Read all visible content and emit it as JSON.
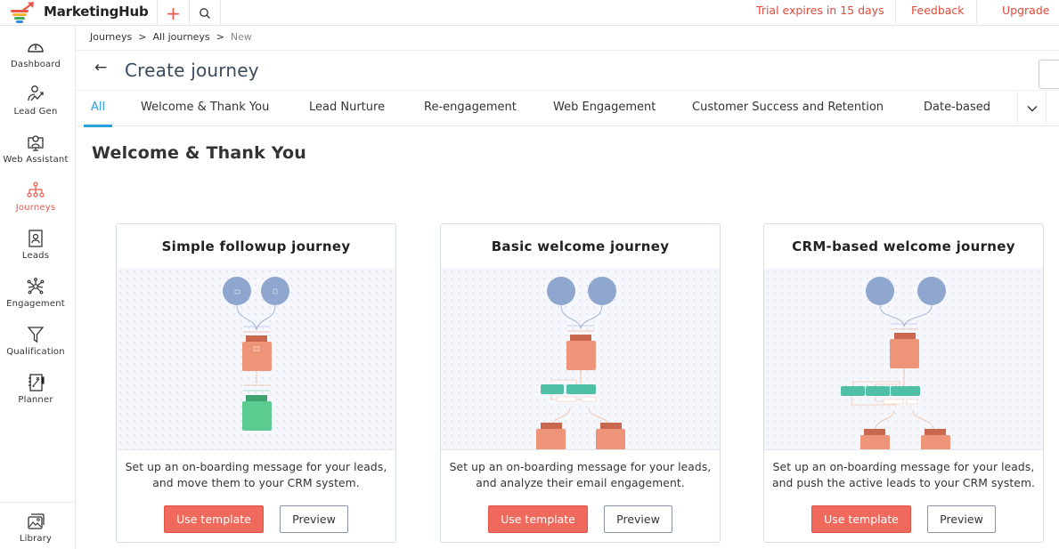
{
  "app": {
    "name": "MarketingHub"
  },
  "topbar": {
    "trial_text": "Trial expires in 15 days",
    "feedback_label": "Feedback",
    "upgrade_label": "Upgrade",
    "accent_color": "#e04b3c"
  },
  "sidebar": {
    "items": [
      {
        "label": "Dashboard",
        "icon": "gauge-icon"
      },
      {
        "label": "Lead Gen",
        "icon": "lead-gen-icon"
      },
      {
        "label": "Web Assistant",
        "icon": "web-assistant-icon"
      },
      {
        "label": "Journeys",
        "icon": "journeys-icon",
        "active": true
      },
      {
        "label": "Leads",
        "icon": "leads-icon"
      },
      {
        "label": "Engagement",
        "icon": "engagement-icon"
      },
      {
        "label": "Qualification",
        "icon": "funnel-icon"
      },
      {
        "label": "Planner",
        "icon": "planner-icon"
      }
    ],
    "library": {
      "label": "Library",
      "icon": "image-gallery-icon"
    }
  },
  "breadcrumb": {
    "items": [
      "Journeys",
      "All journeys"
    ],
    "current": "New",
    "separator": ">"
  },
  "page": {
    "title": "Create journey"
  },
  "tabs": [
    {
      "label": "All",
      "active": true
    },
    {
      "label": "Welcome & Thank You"
    },
    {
      "label": "Lead Nurture"
    },
    {
      "label": "Re-engagement"
    },
    {
      "label": "Web Engagement"
    },
    {
      "label": "Customer Success and Retention"
    },
    {
      "label": "Date-based"
    }
  ],
  "section": {
    "title": "Welcome & Thank You"
  },
  "cards": [
    {
      "title": "Simple followup journey",
      "description_line1": "Set up an on-boarding message for your leads,",
      "description_line2": "and move them to your CRM system.",
      "use_label": "Use template",
      "preview_label": "Preview"
    },
    {
      "title": "Basic welcome journey",
      "description_line1": "Set up an on-boarding message for your leads,",
      "description_line2": "and analyze their email engagement.",
      "use_label": "Use template",
      "preview_label": "Preview"
    },
    {
      "title": "CRM-based welcome journey",
      "description_line1": "Set up an on-boarding message for your leads,",
      "description_line2": "and push the active leads to your CRM system.",
      "use_label": "Use template",
      "preview_label": "Preview"
    }
  ],
  "colors": {
    "accent_red": "#ef6a5c",
    "tab_active": "#2b9fe0",
    "node_trigger": "#8fa6cf",
    "node_message": "#ee9478",
    "node_green": "#5bcb8f",
    "node_teal": "#4fbfa5"
  }
}
